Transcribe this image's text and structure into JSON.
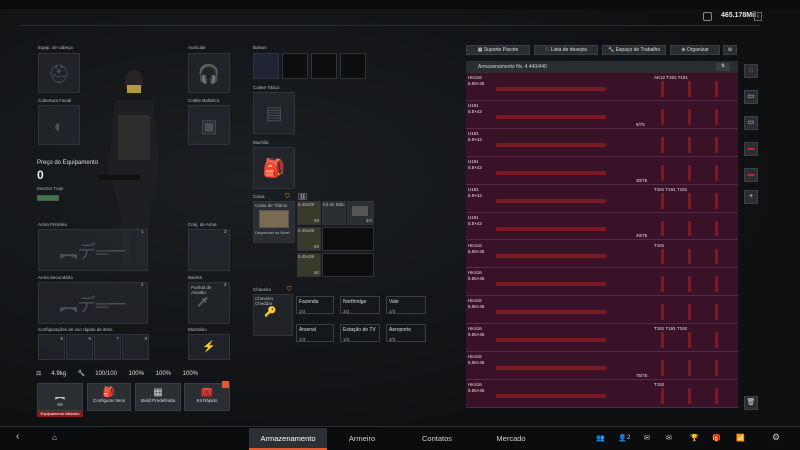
{
  "wallet": {
    "amount": "465.178Mil"
  },
  "equipment": {
    "helmet": "Equip. de cabeça",
    "earpiece": "Auricular",
    "face": "Cobertura Facial",
    "vest": "Colete Balístico",
    "price_label": "Preço do Equipamento",
    "price_value": "0",
    "show_outfit": "Mostrar Traje",
    "primary": "Arma Primária",
    "primary_slot": "1",
    "weapon_set": "Conj. de Arma",
    "weapon_set_slot": "3",
    "secondary": "Arma Secundária",
    "secondary_slot": "2",
    "sheath": "Bainha",
    "knife": "Punhal de Assalto",
    "knife_slot": "4",
    "quick_config": "Configurações de uso rápido de itens",
    "quick_slots": [
      "5",
      "6",
      "7",
      "8"
    ],
    "ammo_menu": "Mostrário"
  },
  "stats": {
    "weight": "4.9kg",
    "durability": "100/100",
    "s1": "100%",
    "s2": "100%",
    "s3": "100%"
  },
  "actions": {
    "kit": "Kit",
    "kit_status": "Equipamento faltando",
    "config": "Configurar Itens",
    "preset": "Build Predefinida",
    "quick_kit": "Kit Rápido"
  },
  "containers": {
    "pockets": "Bolsos",
    "tactical": "Colete Tático",
    "backpack": "Mochila",
    "case": "Caixa",
    "case_title": "Caixa de Titânio",
    "case_note": "Disponível no Nível",
    "ammo_label": "5.45x39",
    "ammo_count": "60",
    "kit_label": "Kit de Mão",
    "kit_count": "3/4",
    "keyring": "Chaveiro",
    "keyring_name": "Chaveiro Cheddar"
  },
  "keyslots": [
    {
      "name": "Fazenda",
      "value": "3/3"
    },
    {
      "name": "Northridge",
      "value": "3/3"
    },
    {
      "name": "Vale",
      "value": "3/3"
    },
    {
      "name": "Arsenal",
      "value": "1/3"
    },
    {
      "name": "Estação de TV",
      "value": "1/3"
    },
    {
      "name": "Aeroporto",
      "value": "3/3"
    }
  ],
  "storage_tabs": {
    "support": "Suporte Pacote",
    "wishlist": "Lista de desejos",
    "workspace": "Espaço de Trabalho",
    "organize": "Organizar"
  },
  "storage": {
    "title": "Armazenamento Nv. 4  440/440",
    "rows": [
      {
        "name": "HK416",
        "cal": "5.56×45",
        "count": "",
        "right": "AK12   T191   T191"
      },
      {
        "name": "U191",
        "cal": "5.8×42",
        "count": "9/75",
        "right": ""
      },
      {
        "name": "U191",
        "cal": "5.8×42",
        "count": "",
        "right": ""
      },
      {
        "name": "U191",
        "cal": "5.8×42",
        "count": "30/75",
        "right": ""
      },
      {
        "name": "U191",
        "cal": "5.8×42",
        "count": "",
        "right": "T191   T191   T191"
      },
      {
        "name": "U191",
        "cal": "5.8×42",
        "count": "40/75",
        "right": ""
      },
      {
        "name": "HK416",
        "cal": "5.56×45",
        "count": "",
        "right": "T191"
      },
      {
        "name": "HK416",
        "cal": "5.56×45",
        "count": "",
        "right": ""
      },
      {
        "name": "HK416",
        "cal": "5.56×45",
        "count": "",
        "right": ""
      },
      {
        "name": "HK416",
        "cal": "5.56×45",
        "count": "",
        "right": "T191   T191   T192"
      },
      {
        "name": "HK416",
        "cal": "5.56×45",
        "count": "75/75",
        "right": ""
      },
      {
        "name": "HK416",
        "cal": "5.56×45",
        "count": "",
        "right": "T192"
      }
    ]
  },
  "nav": {
    "tabs": [
      "Armazenamento",
      "Armeiro",
      "Contatos",
      "Mercado"
    ],
    "party": "2"
  }
}
